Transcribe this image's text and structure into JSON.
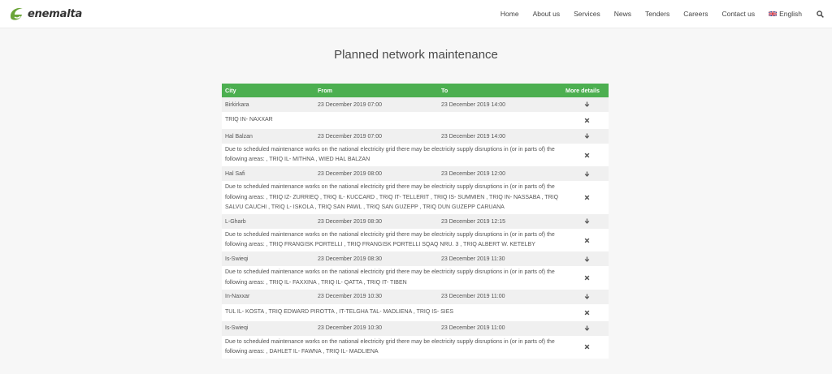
{
  "brand": {
    "name": "enemalta",
    "color": "#6ba539"
  },
  "nav": {
    "home": "Home",
    "about": "About us",
    "services": "Services",
    "news": "News",
    "tenders": "Tenders",
    "careers": "Careers",
    "contact": "Contact us",
    "language": "English"
  },
  "page": {
    "title": "Planned network maintenance"
  },
  "table": {
    "header_color": "#4caf50",
    "headers": {
      "city": "City",
      "from": "From",
      "to": "To",
      "details": "More details"
    },
    "rows": [
      {
        "city": "Birkirkara",
        "from": "23 December 2019 07:00",
        "to": "23 December 2019 14:00",
        "details": "TRIQ IN- NAXXAR"
      },
      {
        "city": "Hal Balzan",
        "from": "23 December 2019 07:00",
        "to": "23 December 2019 14:00",
        "details": "Due to scheduled maintenance works on the national electricity grid there may be electricity supply disruptions in (or in parts of) the following areas: , TRIQ IL- MITHNA , WIED HAL BALZAN"
      },
      {
        "city": "Hal Safi",
        "from": "23 December 2019 08:00",
        "to": "23 December 2019 12:00",
        "details": "Due to scheduled maintenance works on the national electricity grid there may be electricity supply disruptions in (or in parts of) the following areas: , TRIQ IZ- ZURRIEQ , TRIQ IL- KUCCARD , TRIQ IT- TELLERIT , TRIQ IS- SUMMIEN , TRIQ IN- NASSABA , TRIQ SALVU CAUCHI , TRIQ L- ISKOLA , TRIQ SAN PAWL , TRIQ SAN GUZEPP , TRIQ DUN GUZEPP CARUANA"
      },
      {
        "city": "L-Gharb",
        "from": "23 December 2019 08:30",
        "to": "23 December 2019 12:15",
        "details": "Due to scheduled maintenance works on the national electricity grid there may be electricity supply disruptions in (or in parts of) the following areas: , TRIQ FRANGISK PORTELLI , TRIQ FRANGISK PORTELLI SQAQ NRU. 3 , TRIQ ALBERT W. KETELBY"
      },
      {
        "city": "Is-Swieqi",
        "from": "23 December 2019 08:30",
        "to": "23 December 2019 11:30",
        "details": "Due to scheduled maintenance works on the national electricity grid there may be electricity supply disruptions in (or in parts of) the following areas: , TRIQ IL- FAXXINA , TRIQ IL- QATTA , TRIQ IT- TIBEN"
      },
      {
        "city": "In-Naxxar",
        "from": "23 December 2019 10:30",
        "to": "23 December 2019 11:00",
        "details": "TUL IL- KOSTA , TRIQ EDWARD PIROTTA , IT-TELGHA TAL- MADLIENA , TRIQ IS- SIES"
      },
      {
        "city": "Is-Swieqi",
        "from": "23 December 2019 10:30",
        "to": "23 December 2019 11:00",
        "details": "Due to scheduled maintenance works on the national electricity grid there may be electricity supply disruptions in (or in parts of) the following areas: , DAHLET IL- FAWNA , TRIQ IL- MADLIENA"
      }
    ]
  }
}
